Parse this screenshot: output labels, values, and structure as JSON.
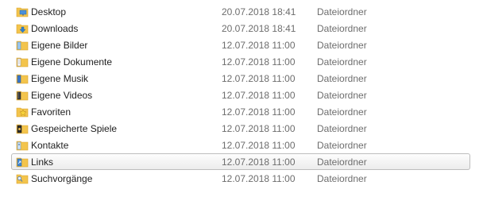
{
  "files": [
    {
      "name": "Desktop",
      "date": "20.07.2018 18:41",
      "type": "Dateiordner",
      "icon": "folder-desktop-icon"
    },
    {
      "name": "Downloads",
      "date": "20.07.2018 18:41",
      "type": "Dateiordner",
      "icon": "folder-downloads-icon"
    },
    {
      "name": "Eigene Bilder",
      "date": "12.07.2018 11:00",
      "type": "Dateiordner",
      "icon": "folder-pictures-icon"
    },
    {
      "name": "Eigene Dokumente",
      "date": "12.07.2018 11:00",
      "type": "Dateiordner",
      "icon": "folder-documents-icon"
    },
    {
      "name": "Eigene Musik",
      "date": "12.07.2018 11:00",
      "type": "Dateiordner",
      "icon": "folder-music-icon"
    },
    {
      "name": "Eigene Videos",
      "date": "12.07.2018 11:00",
      "type": "Dateiordner",
      "icon": "folder-videos-icon"
    },
    {
      "name": "Favoriten",
      "date": "12.07.2018 11:00",
      "type": "Dateiordner",
      "icon": "folder-favorites-icon"
    },
    {
      "name": "Gespeicherte Spiele",
      "date": "12.07.2018 11:00",
      "type": "Dateiordner",
      "icon": "folder-games-icon"
    },
    {
      "name": "Kontakte",
      "date": "12.07.2018 11:00",
      "type": "Dateiordner",
      "icon": "folder-contacts-icon"
    },
    {
      "name": "Links",
      "date": "12.07.2018 11:00",
      "type": "Dateiordner",
      "icon": "folder-links-icon"
    },
    {
      "name": "Suchvorgänge",
      "date": "12.07.2018 11:00",
      "type": "Dateiordner",
      "icon": "folder-searches-icon"
    }
  ],
  "hovered_index": 9,
  "colors": {
    "folder": "#f3c44c",
    "folder_dark": "#d9a12a",
    "hover_border": "#bdbdbd",
    "meta_text": "#6d6d6d"
  }
}
